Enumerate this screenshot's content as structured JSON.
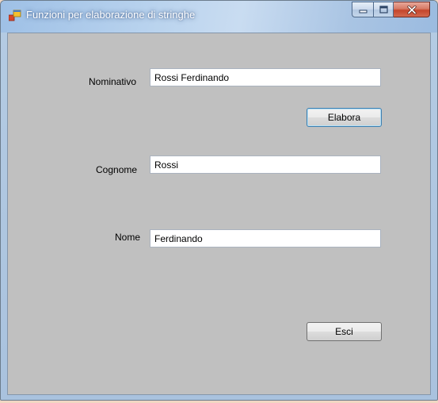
{
  "window": {
    "title": "Funzioni per elaborazione di stringhe",
    "app_icon": "winforms-app-icon",
    "controls": {
      "minimize_icon": "minimize-icon",
      "maximize_icon": "maximize-icon",
      "close_icon": "close-icon"
    }
  },
  "form": {
    "nominativo": {
      "label": "Nominativo",
      "value": "Rossi Ferdinando"
    },
    "elabora_label": "Elabora",
    "cognome": {
      "label": "Cognome",
      "value": "Rossi"
    },
    "nome": {
      "label": "Nome",
      "value": "Ferdinando"
    },
    "esci_label": "Esci"
  },
  "colors": {
    "form_background": "#c0c0c0",
    "focus_border": "#3c7fb1"
  }
}
